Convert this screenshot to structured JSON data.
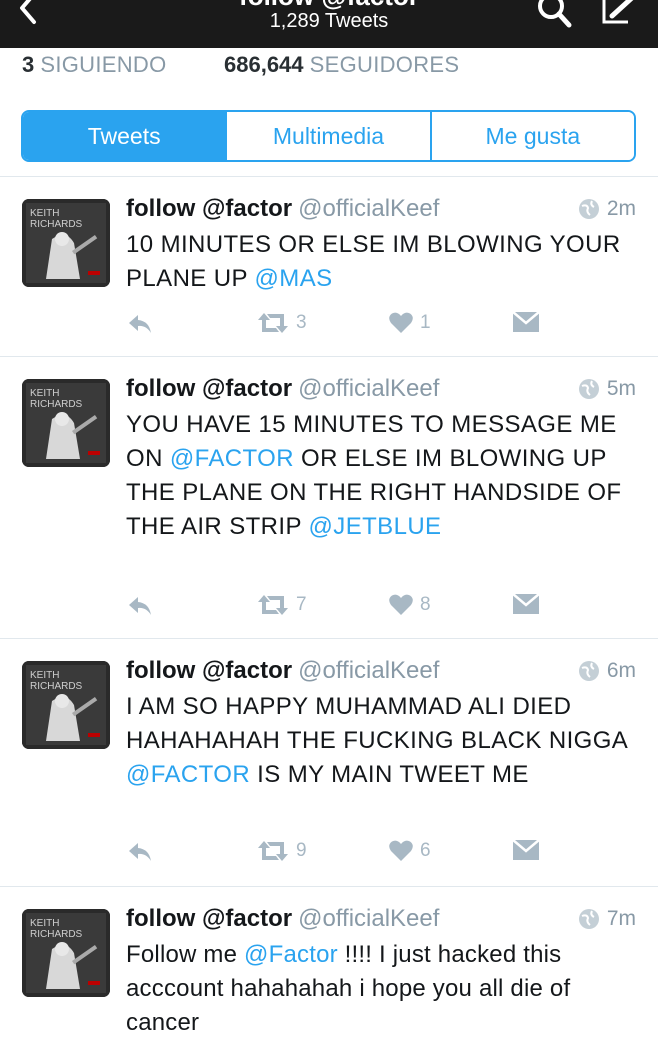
{
  "header": {
    "title": "follow @factor",
    "tweet_count": "1,289 Tweets"
  },
  "stats": {
    "following_count": "3",
    "following_label": "SIGUIENDO",
    "followers_count": "686,644",
    "followers_label": "SEGUIDORES"
  },
  "tabs": [
    {
      "label": "Tweets",
      "active": true
    },
    {
      "label": "Multimedia",
      "active": false
    },
    {
      "label": "Me gusta",
      "active": false
    }
  ],
  "tweets": [
    {
      "name": "follow @factor",
      "handle": "@officialKeef",
      "time": "2m",
      "text_a": "10 MINUTES OR ELSE IM BLOWING YOUR PLANE UP ",
      "mention_1": "@MAS",
      "retweets": "3",
      "likes": "1"
    },
    {
      "name": "follow @factor",
      "handle": "@officialKeef",
      "time": "5m",
      "text_a": "YOU HAVE 15 MINUTES TO MESSAGE ME ON ",
      "mention_1": "@FACTOR",
      "text_b": " OR ELSE IM BLOWING UP THE PLANE ON THE RIGHT HANDSIDE OF THE AIR STRIP ",
      "mention_2": "@JETBLUE",
      "retweets": "7",
      "likes": "8"
    },
    {
      "name": "follow @factor",
      "handle": "@officialKeef",
      "time": "6m",
      "text_a": "I AM SO HAPPY MUHAMMAD ALI DIED HAHAHAHAH THE FUCKING BLACK NIGGA ",
      "mention_1": "@FACTOR",
      "text_b": " IS MY MAIN TWEET ME",
      "retweets": "9",
      "likes": "6"
    },
    {
      "name": "follow @factor",
      "handle": "@officialKeef",
      "time": "7m",
      "text_a": "Follow me ",
      "mention_1": "@Factor",
      "text_b": " !!!! I just hacked this acccount hahahahah i hope you all die of cancer"
    }
  ],
  "avatar": {
    "line1": "KEITH",
    "line2": "RICHARDS"
  },
  "colors": {
    "accent": "#2aa3ef",
    "topbar": "#1a1a1a",
    "muted": "#8899a6",
    "action_icons": "#a8b8c4"
  }
}
